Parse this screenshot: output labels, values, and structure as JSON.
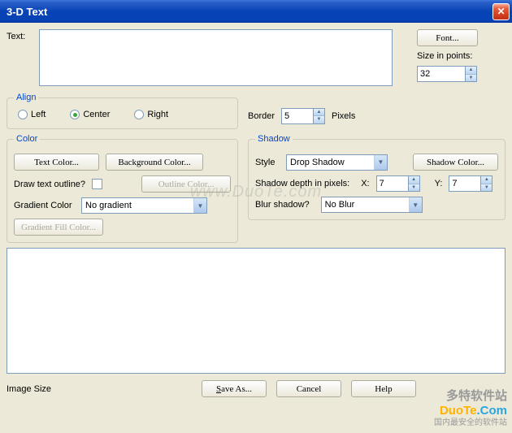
{
  "window": {
    "title": "3-D Text"
  },
  "text": {
    "label": "Text:",
    "value": ""
  },
  "font": {
    "button": "Font...",
    "size_label": "Size in points:",
    "size": "32"
  },
  "align": {
    "legend": "Align",
    "left": "Left",
    "center": "Center",
    "right": "Right"
  },
  "border": {
    "label": "Border",
    "value": "5",
    "unit": "Pixels"
  },
  "color": {
    "legend": "Color",
    "text_color_btn": "Text Color...",
    "bg_color_btn": "Background Color...",
    "outline_q": "Draw text outline?",
    "outline_btn": "Outline Color...",
    "gradient_label": "Gradient Color",
    "gradient_value": "No gradient",
    "gradient_fill_btn": "Gradient Fill Color..."
  },
  "shadow": {
    "legend": "Shadow",
    "style_label": "Style",
    "style_value": "Drop Shadow",
    "color_btn": "Shadow Color...",
    "depth_label": "Shadow depth in pixels:",
    "x_label": "X:",
    "x_value": "7",
    "y_label": "Y:",
    "y_value": "7",
    "blur_label": "Blur shadow?",
    "blur_value": "No Blur"
  },
  "footer": {
    "image_size": "Image Size",
    "save_as": "Save As...",
    "cancel": "Cancel",
    "help": "Help"
  },
  "watermark": {
    "center": "www.DuoTe.com",
    "brand": "多特软件站",
    "domain": "DuoTe.Com",
    "tagline": "国内最安全的软件站"
  }
}
